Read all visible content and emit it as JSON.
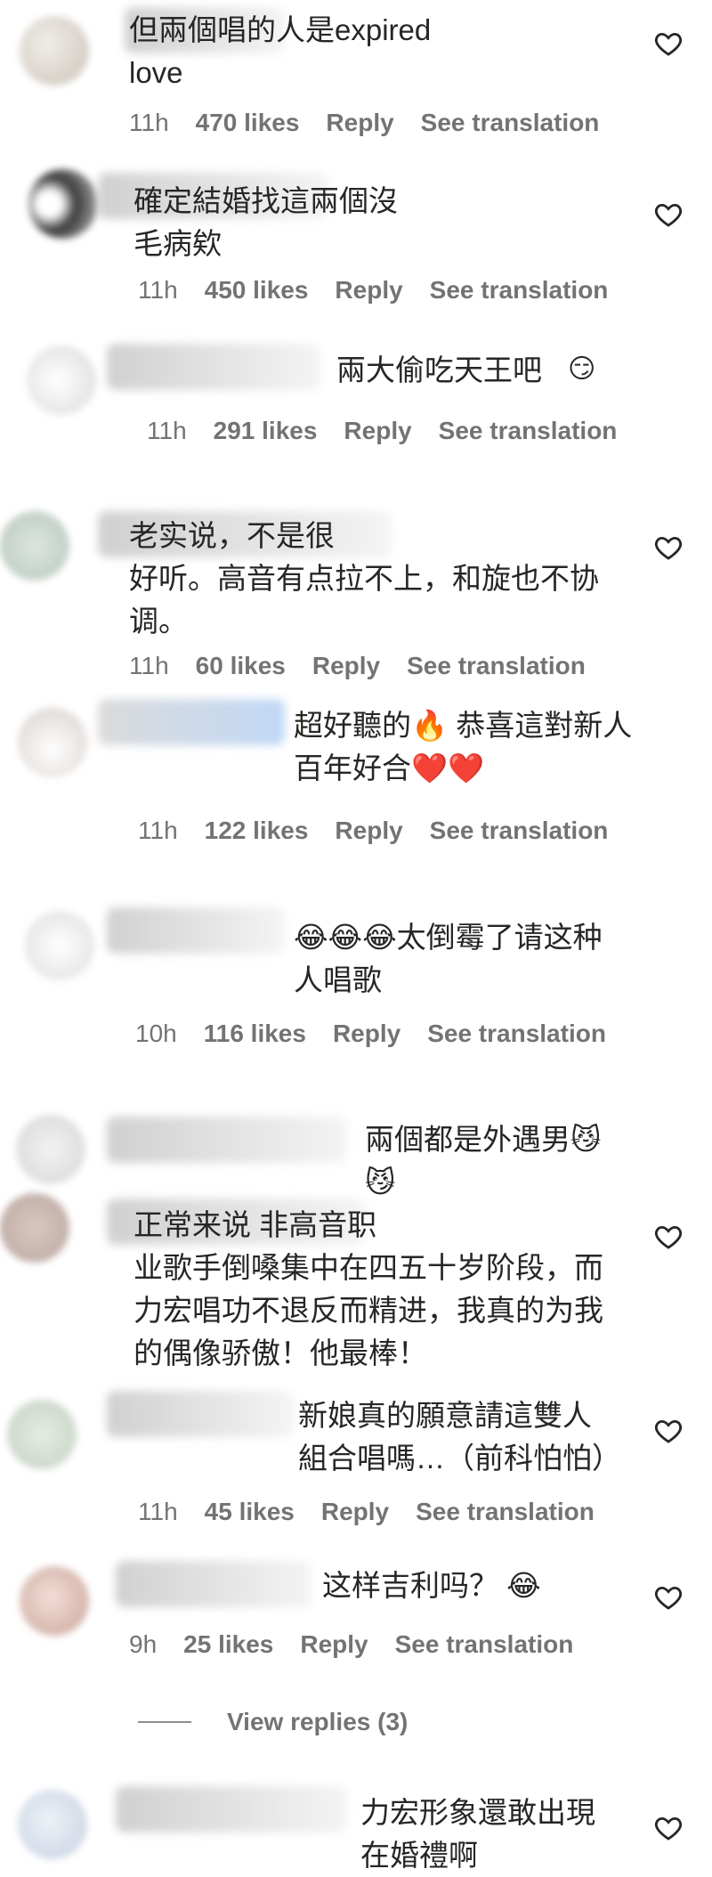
{
  "comments": [
    {
      "text": "但兩個唱的人是expired\nlove",
      "emoji_suffix": "",
      "time": "11h",
      "likes": "470 likes",
      "reply": "Reply",
      "translate": "See translation"
    },
    {
      "text": "確定結婚找這兩個沒\n毛病欸",
      "time": "11h",
      "likes": "450 likes",
      "reply": "Reply",
      "translate": "See translation"
    },
    {
      "text": "兩大偷吃天王吧",
      "time": "11h",
      "likes": "291 likes",
      "reply": "Reply",
      "translate": "See translation"
    },
    {
      "text": "老实说，不是很\n好听。高音有点拉不上，和旋也不协\n调。",
      "time": "11h",
      "likes": "60 likes",
      "reply": "Reply",
      "translate": "See translation"
    },
    {
      "text": "超好聽的🔥 恭喜這對新人\n百年好合❤️❤️",
      "time": "11h",
      "likes": "122 likes",
      "reply": "Reply",
      "translate": "See translation"
    },
    {
      "text": "😂😂😂太倒霉了请这种\n人唱歌",
      "time": "10h",
      "likes": "116 likes",
      "reply": "Reply",
      "translate": "See translation"
    },
    {
      "text": "兩個都是外遇男😼\n😼"
    },
    {
      "text": "正常来说 非高音职\n业歌手倒嗓集中在四五十岁阶段，而\n力宏唱功不退反而精进，我真的为我\n的偶像骄傲！他最棒！"
    },
    {
      "text": "新娘真的願意請這雙人\n組合唱嗎…（前科怕怕）",
      "time": "11h",
      "likes": "45 likes",
      "reply": "Reply",
      "translate": "See translation"
    },
    {
      "text": "这样吉利吗？ 😂",
      "time": "9h",
      "likes": "25 likes",
      "reply": "Reply",
      "translate": "See translation"
    },
    {
      "text": "力宏形象還敢出現\n在婚禮啊"
    }
  ],
  "view_replies": "View replies (3)",
  "colors": {
    "text": "#262626",
    "meta": "#737373",
    "heart": "#262626"
  },
  "icons": {
    "like": "heart-outline-icon"
  }
}
